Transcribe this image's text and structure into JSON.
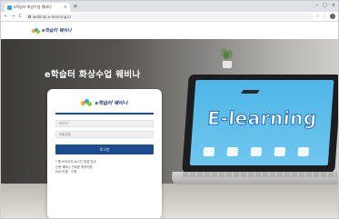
{
  "browser": {
    "tab_title": "e학습터 화상수업 웨비나",
    "tab_close": "×",
    "new_tab": "+",
    "window_controls": [
      "–",
      "□",
      "×"
    ],
    "url": "webinar.e-learning.kr",
    "nav": {
      "back": "←",
      "forward": "→",
      "reload": "C"
    },
    "toolbar_icons": [
      "☆",
      "⋮"
    ]
  },
  "site": {
    "logo_text": "e학습터 웨비나"
  },
  "hero": {
    "title": "e학습터 화상수업 웨비나",
    "screen_text": "E-learning"
  },
  "login": {
    "logo_text": "e학습터 웨비나",
    "id_placeholder": "아이디",
    "pw_placeholder": "비밀번호",
    "button_label": "로그인",
    "notes": [
      "* 웹 브라우저 로그인 방법 안내",
      "인증 웨비나 안내문 원격지원",
      "FAQ 도움 · 이용"
    ]
  },
  "colors": {
    "brand_navy": "#1c4c8f",
    "screen_blue": "#4fb6e6"
  }
}
